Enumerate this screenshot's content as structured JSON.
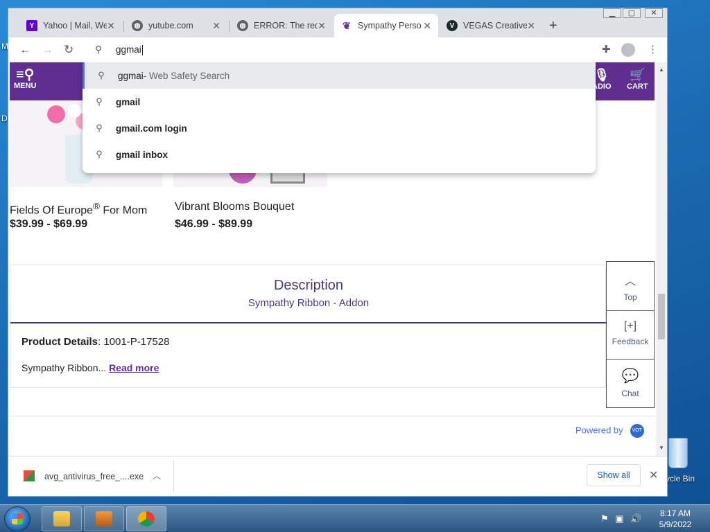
{
  "desktop": {
    "edge_text_1": "M",
    "edge_text_2": "D",
    "recycle_bin_label": "ycle Bin"
  },
  "tabs": [
    {
      "title": "Yahoo | Mail, We",
      "favicon": "yahoo-icon",
      "close": "✕"
    },
    {
      "title": "yutube.com",
      "favicon": "globe-icon",
      "close": "✕"
    },
    {
      "title": "ERROR: The requ",
      "favicon": "globe-icon",
      "close": "✕"
    },
    {
      "title": "Sympathy Perso",
      "favicon": "flower-icon",
      "close": "✕",
      "active": true
    },
    {
      "title": "VEGAS Creative",
      "favicon": "vegas-icon",
      "close": "✕"
    }
  ],
  "new_tab_glyph": "+",
  "omnibox": {
    "value": "ggmai"
  },
  "suggestions": [
    {
      "main": "ggmai",
      "hint": " - Web Safety Search"
    },
    {
      "main": "gmail",
      "hint": ""
    },
    {
      "main": "gmail.com login",
      "hint": ""
    },
    {
      "main": "gmail inbox",
      "hint": ""
    }
  ],
  "site_header": {
    "menu_label": "MENU",
    "radio_label": "ADIO",
    "cart_label": "CART"
  },
  "products": [
    {
      "name": "Fields Of Europe",
      "reg": "®",
      "name_tail": " For Mom",
      "price": "$39.99 - $69.99"
    },
    {
      "name": "Vibrant Blooms Bouquet",
      "price": "$46.99 - $89.99"
    }
  ],
  "description": {
    "title": "Description",
    "subtitle": "Sympathy Ribbon - Addon",
    "details_label": "Product Details",
    "details_value": ": 1001-P-17528",
    "text": "Sympathy Ribbon...",
    "read_more": "Read more"
  },
  "side_panel": {
    "top": "Top",
    "feedback_icon": "[+]",
    "feedback": "Feedback",
    "chat": "Chat"
  },
  "powered_by": "Powered by",
  "powered_badge": "VOT",
  "download": {
    "file": "avg_antivirus_free_....exe",
    "show_all": "Show all"
  },
  "clock": {
    "time": "8:17 AM",
    "date": "5/9/2022"
  }
}
